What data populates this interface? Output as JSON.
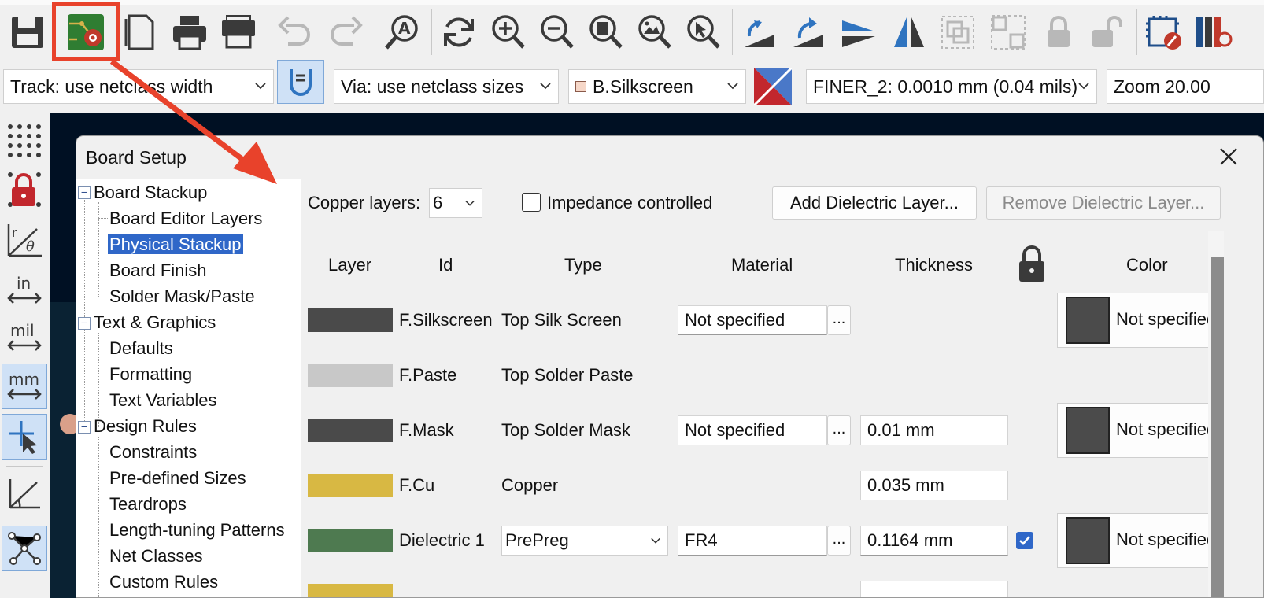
{
  "toolbar": {
    "icons": [
      "save-icon",
      "board-setup-icon",
      "page-settings-icon",
      "print-icon",
      "plot-icon",
      "undo-icon",
      "redo-icon",
      "find-icon",
      "refresh-icon",
      "zoom-in-icon",
      "zoom-out-icon",
      "zoom-fit-icon",
      "zoom-objects-icon",
      "zoom-selection-icon",
      "rotate-ccw-icon",
      "rotate-cw-icon",
      "flip-icon",
      "mirror-icon",
      "group-icon",
      "ungroup-icon",
      "lock-icon",
      "unlock-icon",
      "footprint-editor-icon",
      "footprint-browser-icon"
    ]
  },
  "toolbar2": {
    "track_width": "Track: use netclass width",
    "via_size": "Via: use netclass sizes",
    "layer": "B.Silkscreen",
    "grid": "FINER_2: 0.0010 mm (0.04 mils)",
    "zoom": "Zoom 20.00"
  },
  "left_toolbar": {
    "in_label": "in",
    "mil_label": "mil",
    "mm_label": "mm"
  },
  "dialog": {
    "title": "Board Setup",
    "tree": [
      {
        "label": "Board Stackup",
        "level": 0
      },
      {
        "label": "Board Editor Layers",
        "level": 1
      },
      {
        "label": "Physical Stackup",
        "level": 1,
        "selected": true
      },
      {
        "label": "Board Finish",
        "level": 1
      },
      {
        "label": "Solder Mask/Paste",
        "level": 1
      },
      {
        "label": "Text & Graphics",
        "level": 0
      },
      {
        "label": "Defaults",
        "level": 1
      },
      {
        "label": "Formatting",
        "level": 1
      },
      {
        "label": "Text Variables",
        "level": 1
      },
      {
        "label": "Design Rules",
        "level": 0
      },
      {
        "label": "Constraints",
        "level": 1
      },
      {
        "label": "Pre-defined Sizes",
        "level": 1
      },
      {
        "label": "Teardrops",
        "level": 1
      },
      {
        "label": "Length-tuning Patterns",
        "level": 1
      },
      {
        "label": "Net Classes",
        "level": 1
      },
      {
        "label": "Custom Rules",
        "level": 1
      }
    ],
    "copper_layers_label": "Copper layers:",
    "copper_layers_value": "6",
    "impedance_label": "Impedance controlled",
    "add_dielectric": "Add Dielectric Layer...",
    "remove_dielectric": "Remove Dielectric Layer...",
    "columns": [
      "Layer",
      "Id",
      "Type",
      "Material",
      "Thickness",
      "Color"
    ],
    "rows": [
      {
        "swatch": "#4a4a4a",
        "id": "F.Silkscreen",
        "type": "Top Silk Screen",
        "material": "Not specified",
        "thickness": "",
        "color": "Not specified"
      },
      {
        "swatch": "#c8c8c8",
        "id": "F.Paste",
        "type": "Top Solder Paste",
        "material": "",
        "thickness": "",
        "color": ""
      },
      {
        "swatch": "#4a4a4a",
        "id": "F.Mask",
        "type": "Top Solder Mask",
        "material": "Not specified",
        "thickness": "0.01 mm",
        "color": "Not specified"
      },
      {
        "swatch": "#d8b843",
        "id": "F.Cu",
        "type": "Copper",
        "material": "",
        "thickness": "0.035 mm",
        "color": ""
      },
      {
        "swatch": "#4e7a50",
        "id": "Dielectric 1",
        "type": "PrePreg",
        "material": "FR4",
        "thickness": "0.1164 mm",
        "locked": true,
        "color": "Not specified"
      },
      {
        "swatch": "#d8b843",
        "id": "",
        "type": "",
        "material": "",
        "thickness": "",
        "color": ""
      }
    ],
    "dots": "...",
    "close_icon": "close-icon",
    "lock_icon": "lock-icon"
  },
  "annotation": {
    "highlight_color": "#e8422b"
  }
}
